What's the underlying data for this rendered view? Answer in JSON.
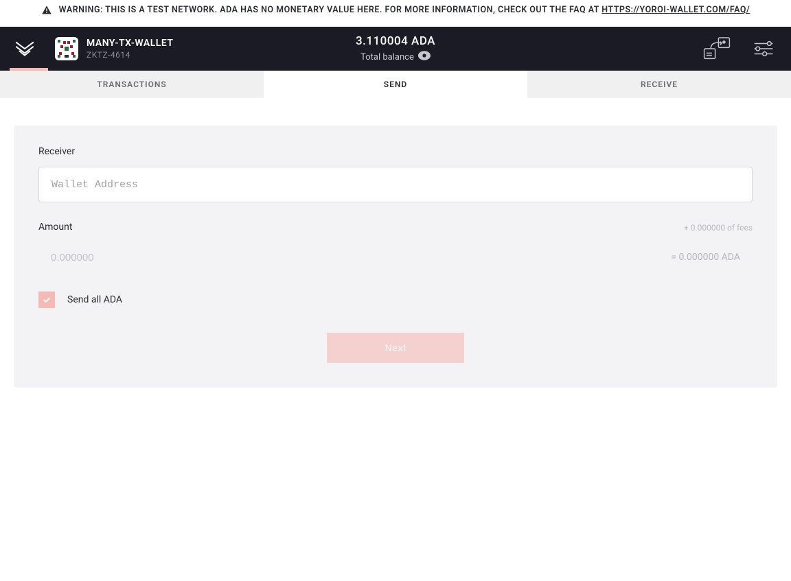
{
  "warning": {
    "text_prefix": "WARNING: THIS IS A TEST NETWORK. ADA HAS NO MONETARY VALUE HERE. FOR MORE INFORMATION, CHECK OUT THE FAQ AT ",
    "link_text": "HTTPS://YOROI-WALLET.COM/FAQ/"
  },
  "wallet": {
    "name": "MANY-TX-WALLET",
    "id": "ZKTZ-4614"
  },
  "balance": {
    "amount": "3.110004 ADA",
    "label": "Total balance"
  },
  "tabs": {
    "transactions": "TRANSACTIONS",
    "send": "SEND",
    "receive": "RECEIVE"
  },
  "form": {
    "receiver_label": "Receiver",
    "receiver_placeholder": "Wallet Address",
    "amount_label": "Amount",
    "fees_text": "+ 0.000000 of fees",
    "amount_placeholder": "0.000000",
    "amount_equals": "= 0.000000 ADA",
    "send_all_label": "Send all ADA",
    "next_button": "Next"
  },
  "icons": {
    "app": "yoroi-icon",
    "warning": "warning-triangle-icon",
    "eye": "eye-icon",
    "delegation": "delegation-icon",
    "settings": "settings-sliders-icon",
    "check": "checkmark-icon"
  }
}
